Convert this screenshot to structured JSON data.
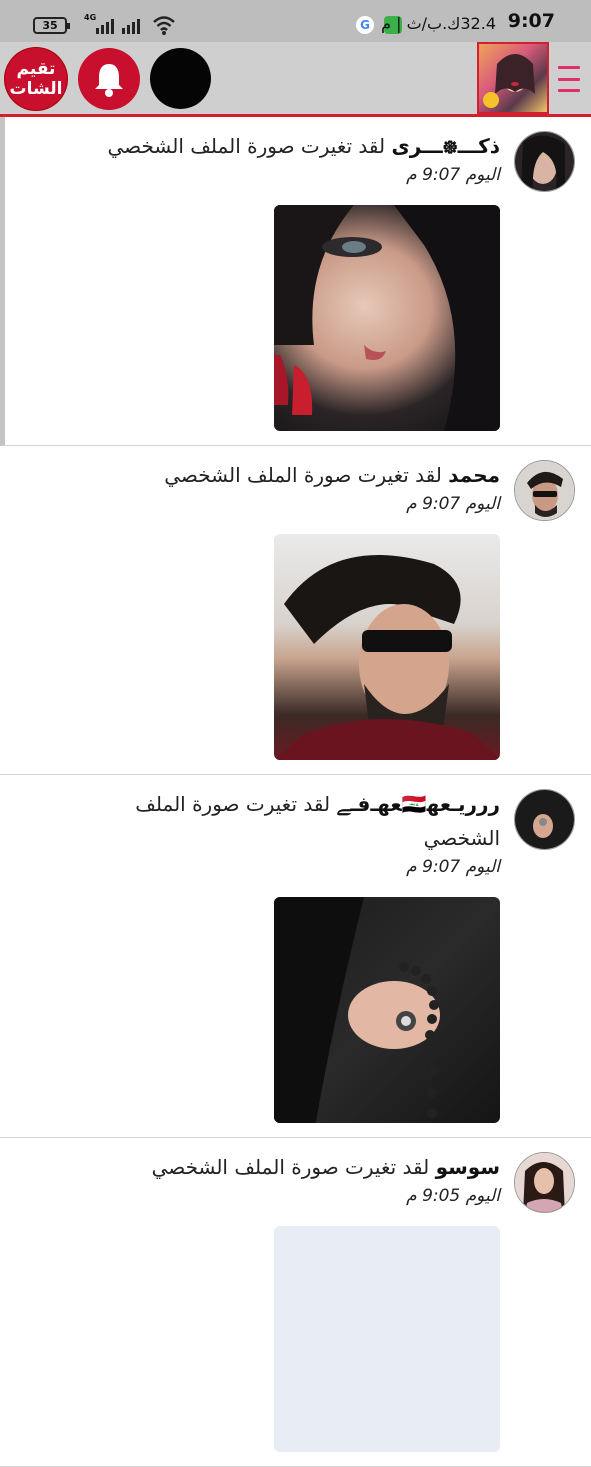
{
  "status_bar": {
    "time": "9:07",
    "speed": "32.4ك.ب/ث | م",
    "battery": "35",
    "network": "4G"
  },
  "header": {
    "rating_label": "تقيم الشات",
    "icons": [
      "bell-icon",
      "profile-avatar",
      "menu-icon"
    ],
    "accent_color": "#d32030"
  },
  "posts": [
    {
      "name": "ذكـــ᪥ـــرى",
      "message": " لقد تغيرت صورة الملف الشخصي",
      "time": "اليوم 9:07 م"
    },
    {
      "name": "محمد",
      "message": " لقد تغيرت صورة الملف الشخصي",
      "time": "اليوم 9:07 م"
    },
    {
      "name": "ﺭﺭﺭﻳـﻌﮭ🇮🇶ﻌﮭـﻓـﮯ",
      "message": " لقد تغيرت صورة الملف الشخصي",
      "time": "اليوم 9:07 م"
    },
    {
      "name": "سوسو",
      "message": " لقد تغيرت صورة الملف الشخصي",
      "time": "اليوم 9:05 م"
    }
  ]
}
